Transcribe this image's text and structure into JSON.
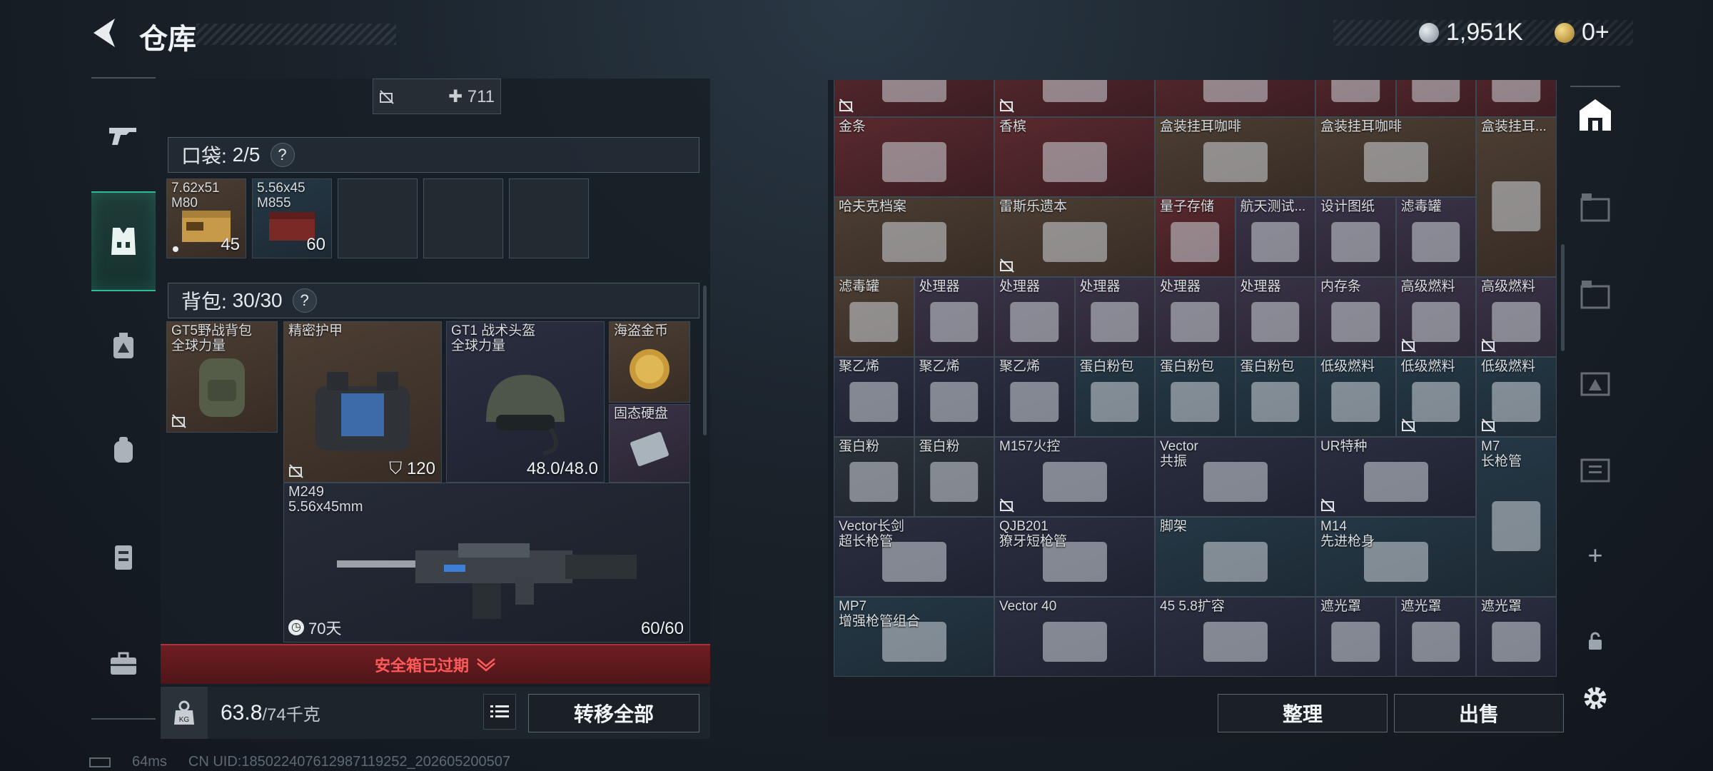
{
  "header": {
    "title": "仓库",
    "silver": "1,951K",
    "gold": "0+"
  },
  "left": {
    "top_item_value": "711",
    "pocket": {
      "label": "口袋:",
      "count": "2/5"
    },
    "pocket_items": [
      {
        "name": "7.62x51\nM80",
        "count": "45"
      },
      {
        "name": "5.56x45\nM855",
        "count": "60"
      }
    ],
    "backpack": {
      "label": "背包:",
      "count": "30/30"
    },
    "backpack_items": {
      "bag": "GT5野战背包\n全球力量",
      "armor": "精密护甲",
      "armor_value": "120",
      "helmet": "GT1 战术头盔\n全球力量",
      "helmet_value": "48.0/48.0",
      "coin": "海盗金币",
      "ssd": "固态硬盘",
      "gun": "M249\n5.56x45mm",
      "gun_time": "70天",
      "gun_ammo": "60/60"
    },
    "expired": "安全箱已过期",
    "weight": "63.8",
    "weight_max": "/74千克",
    "transfer_all": "转移全部"
  },
  "grid": {
    "rows": [
      [
        {
          "n": "",
          "c": "red",
          "lock": true
        },
        {
          "n": "",
          "c": "red",
          "lock": true
        },
        {
          "n": "",
          "c": "red"
        },
        {
          "n": "",
          "c": "red"
        },
        {
          "n": "",
          "c": "red"
        },
        {
          "n": "",
          "c": "red"
        }
      ],
      [
        {
          "n": "金条",
          "c": "red"
        },
        {
          "n": "香槟",
          "c": "red"
        },
        {
          "n": "盒装挂耳咖啡",
          "c": "brown"
        },
        {
          "n": "盒装挂耳咖啡",
          "c": "brown"
        },
        {
          "n": "盒装挂耳...",
          "c": "brown"
        }
      ],
      [
        {
          "n": "哈夫克档案",
          "c": "brown"
        },
        {
          "n": "雷斯乐遗本",
          "c": "brown",
          "lock": true
        },
        {
          "n": "量子存储",
          "c": "red"
        },
        {
          "n": "航天测试...",
          "c": "purple"
        },
        {
          "n": "设计图纸",
          "c": "purple"
        },
        {
          "n": "滤毒罐",
          "c": "purple"
        }
      ],
      [
        {
          "n": "滤毒罐",
          "c": "brown"
        },
        {
          "n": "处理器",
          "c": "purple"
        },
        {
          "n": "处理器",
          "c": "purple"
        },
        {
          "n": "处理器",
          "c": "purple"
        },
        {
          "n": "处理器",
          "c": "purple"
        },
        {
          "n": "处理器",
          "c": "purple"
        },
        {
          "n": "内存条",
          "c": "purple"
        },
        {
          "n": "高级燃料",
          "c": "purple",
          "lock": true
        },
        {
          "n": "高级燃料",
          "c": "purple",
          "lock": true
        }
      ],
      [
        {
          "n": "聚乙烯",
          "c": "navy"
        },
        {
          "n": "聚乙烯",
          "c": "navy"
        },
        {
          "n": "聚乙烯",
          "c": "navy"
        },
        {
          "n": "蛋白粉包",
          "c": "blue"
        },
        {
          "n": "蛋白粉包",
          "c": "blue"
        },
        {
          "n": "蛋白粉包",
          "c": "blue"
        },
        {
          "n": "低级燃料",
          "c": "blue"
        },
        {
          "n": "低级燃料",
          "c": "blue",
          "lock": true
        },
        {
          "n": "低级燃料",
          "c": "blue",
          "lock": true
        }
      ],
      [
        {
          "n": "蛋白粉",
          "c": "dark"
        },
        {
          "n": "蛋白粉",
          "c": "dark"
        },
        {
          "n": "M157火控",
          "c": "navy",
          "lock": true
        },
        {
          "n": "Vector\n共振",
          "c": "navy"
        },
        {
          "n": "UR特种",
          "c": "navy",
          "lock": true
        },
        {
          "n": "M7\n长枪管",
          "c": "blue"
        }
      ],
      [
        {
          "n": "Vector长剑\n超长枪管",
          "c": "navy"
        },
        {
          "n": "QJB201\n獠牙短枪管",
          "c": "navy"
        },
        {
          "n": "脚架",
          "c": "blue"
        },
        {
          "n": "M14\n先进枪身",
          "c": "blue"
        }
      ],
      [
        {
          "n": "MP7\n增强枪管组合",
          "c": "blue"
        },
        {
          "n": "Vector 40",
          "c": "navy"
        },
        {
          "n": "45 5.8扩容",
          "c": "navy"
        },
        {
          "n": "遮光罩",
          "c": "navy"
        },
        {
          "n": "遮光罩",
          "c": "navy"
        },
        {
          "n": "遮光罩",
          "c": "navy"
        }
      ]
    ]
  },
  "actions": {
    "sort": "整理",
    "sell": "出售"
  },
  "status": {
    "ping": "64ms",
    "uid": "CN UID:185022407612987119252_202605200507"
  }
}
